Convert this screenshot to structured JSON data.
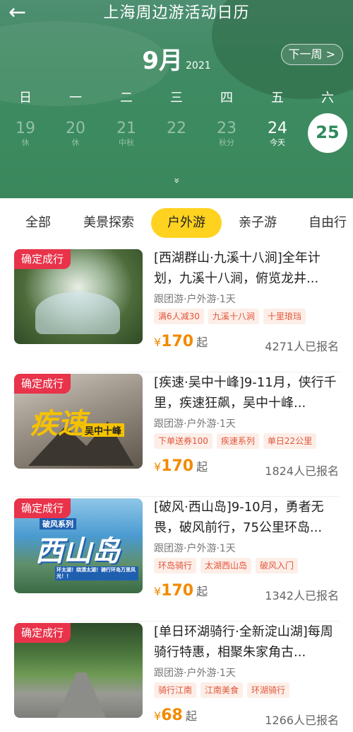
{
  "header": {
    "title": "上海周边游活动日历",
    "month": "9月",
    "year": "2021",
    "next_week": "下一周 >",
    "back_icon": "←",
    "expand_icon": "»",
    "weekdays": [
      "日",
      "一",
      "二",
      "三",
      "四",
      "五",
      "六"
    ],
    "dates": [
      {
        "num": "19",
        "sub": "休"
      },
      {
        "num": "20",
        "sub": "休"
      },
      {
        "num": "21",
        "sub": "中秋"
      },
      {
        "num": "22",
        "sub": ""
      },
      {
        "num": "23",
        "sub": "秋分"
      },
      {
        "num": "24",
        "sub": "今天"
      },
      {
        "num": "25",
        "sub": ""
      }
    ]
  },
  "tabs": [
    "全部",
    "美景探索",
    "户外游",
    "亲子游",
    "自由行"
  ],
  "products": [
    {
      "badge": "确定成行",
      "title": "[西湖群山·九溪十八涧]全年计划，九溪十八涧，俯览龙井...",
      "meta": "跟团游·户外游·1天",
      "tags": [
        "满6人减30",
        "九溪十八涧",
        "十里琅珰"
      ],
      "currency": "¥",
      "price": "170",
      "price_suffix": "起",
      "signups": "4271人已报名"
    },
    {
      "badge": "确定成行",
      "title": "[疾速·吴中十峰]9-11月，侠行千里，疾速狂飙，吴中十峰...",
      "meta": "跟团游·户外游·1天",
      "tags": [
        "下单送券100",
        "疾速系列",
        "单日22公里"
      ],
      "currency": "¥",
      "price": "170",
      "price_suffix": "起",
      "signups": "1824人已报名"
    },
    {
      "badge": "确定成行",
      "title": "[破风·西山岛]9-10月，勇者无畏，破风前行，75公里环岛...",
      "meta": "跟团游·户外游·1天",
      "tags": [
        "环岛骑行",
        "太湖西山岛",
        "破风入门"
      ],
      "currency": "¥",
      "price": "170",
      "price_suffix": "起",
      "signups": "1342人已报名"
    },
    {
      "badge": "确定成行",
      "title": "[单日环湖骑行·全新淀山湖]每周骑行特惠，相聚朱家角古...",
      "meta": "跟团游·户外游·1天",
      "tags": [
        "骑行江南",
        "江南美食",
        "环湖骑行"
      ],
      "currency": "¥",
      "price": "68",
      "price_suffix": "起",
      "signups": "1266人已报名"
    }
  ],
  "thumb_text": {
    "p2_main": "疾速",
    "p2_sub": "吴中十峰",
    "p3_series": "破风系列",
    "p3_main": "西山岛",
    "p3_slogan": "环太湖！绕漂太湖！骑行环岛万里风光！！"
  },
  "colors": {
    "header_green": "#3c8a5f",
    "active_tab": "#ffd21f",
    "badge_red": "#e8334a",
    "price_orange": "#f28a00",
    "tag_text": "#e0563a"
  }
}
